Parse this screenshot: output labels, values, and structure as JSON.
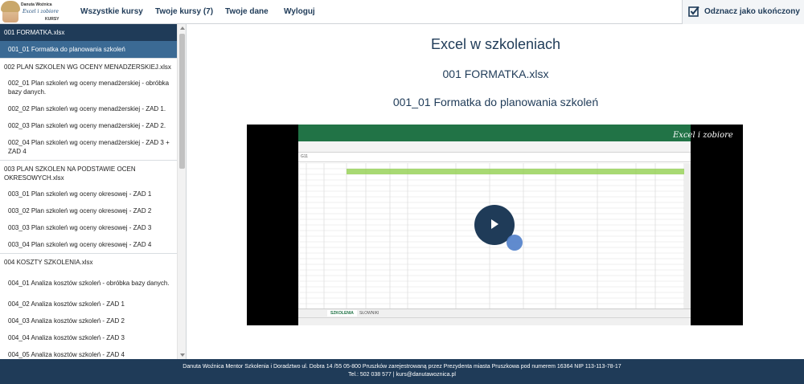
{
  "logo": {
    "name": "Danuta Woźnica",
    "script": "Excel i zobiore",
    "kursy": "KURSY"
  },
  "nav": {
    "all_courses": "Wszystkie kursy",
    "your_courses": "Twoje kursy (7)",
    "your_data": "Twoje dane",
    "logout": "Wyloguj",
    "mark_complete": "Odznacz jako ukończony"
  },
  "sidebar": [
    {
      "type": "section",
      "label": "001 FORMATKA.xlsx",
      "active": true
    },
    {
      "type": "item",
      "label": "001_01 Formatka do planowania szkoleń",
      "active": true
    },
    {
      "type": "section",
      "label": "002 PLAN SZKOLEN WG OCENY MENADZERSKIEJ.xlsx"
    },
    {
      "type": "item",
      "label": "002_01 Plan szkoleń wg oceny menadżerskiej - obróbka bazy danych."
    },
    {
      "type": "item",
      "label": "002_02 Plan szkoleń wg oceny menadżerskiej - ZAD 1."
    },
    {
      "type": "item",
      "label": "002_03 Plan szkoleń wg oceny menadżerskiej - ZAD 2."
    },
    {
      "type": "item",
      "label": "002_04 Plan szkoleń wg oceny menadżerskiej - ZAD 3 + ZAD 4"
    },
    {
      "type": "section",
      "label": "003 PLAN SZKOLEN NA PODSTAWIE OCEN OKRESOWYCH.xlsx"
    },
    {
      "type": "item",
      "label": "003_01 Plan szkoleń wg oceny okresowej - ZAD 1"
    },
    {
      "type": "item",
      "label": "003_02 Plan szkoleń wg oceny okresowej - ZAD 2"
    },
    {
      "type": "item",
      "label": "003_03 Plan szkoleń wg oceny okresowej - ZAD 3"
    },
    {
      "type": "item",
      "label": "003_04 Plan szkoleń wg oceny okresowej - ZAD 4"
    },
    {
      "type": "section",
      "label": "004 KOSZTY SZKOLENIA.xlsx"
    },
    {
      "type": "item",
      "label": "004_01 Analiza kosztów szkoleń - obróbka bazy danych."
    },
    {
      "type": "item",
      "label": "004_02 Analiza kosztów szkoleń - ZAD 1"
    },
    {
      "type": "item",
      "label": "004_03 Analiza kosztów szkoleń - ZAD 2"
    },
    {
      "type": "item",
      "label": "004_04 Analiza kosztów szkoleń - ZAD 3"
    },
    {
      "type": "item",
      "label": "004_05 Analiza kosztów szkoleń - ZAD 4"
    }
  ],
  "main": {
    "title": "Excel w szkoleniach",
    "file": "001 FORMATKA.xlsx",
    "lesson": "001_01 Formatka do planowania szkoleń"
  },
  "video": {
    "watermark": "Excel i zobiore",
    "sheet_tab_1": "SZKOLENIA",
    "sheet_tab_2": "SŁOWNIKI",
    "name_box": "G11"
  },
  "footer": {
    "line1": "Danuta Woźnica Mentor Szkolenia i Doradztwo ul. Dobra 14 /55 05-800 Pruszków zarejestrowaną przez Prezydenta miasta Pruszkowa pod numerem 16364 NIP 113-113-78-17",
    "line2": "Tel.: 502 038 577 | kurs@danutawoznica.pl"
  },
  "colors": {
    "navy": "#1f3b58",
    "active_item": "#3b6a94",
    "excel_green": "#217346"
  }
}
